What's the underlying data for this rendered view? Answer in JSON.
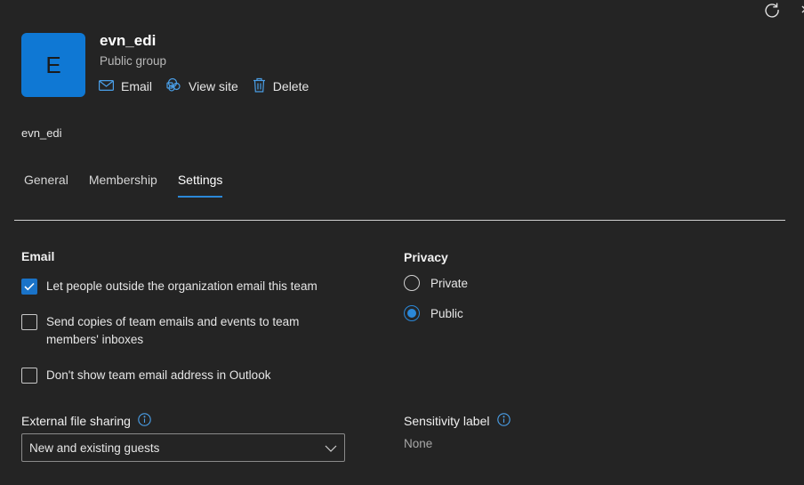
{
  "header": {
    "avatar_letter": "E",
    "group_name": "evn_edi",
    "group_type": "Public group",
    "actions": [
      {
        "label": "Email",
        "icon": "mail-icon"
      },
      {
        "label": "View site",
        "icon": "sharepoint-icon"
      },
      {
        "label": "Delete",
        "icon": "trash-icon"
      }
    ]
  },
  "description": "evn_edi",
  "tabs": [
    {
      "label": "General",
      "active": false
    },
    {
      "label": "Membership",
      "active": false
    },
    {
      "label": "Settings",
      "active": true
    }
  ],
  "email": {
    "title": "Email",
    "options": [
      {
        "label": "Let people outside the organization email this team",
        "checked": true
      },
      {
        "label": "Send copies of team emails and events to team members' inboxes",
        "checked": false
      },
      {
        "label": "Don't show team email address in Outlook",
        "checked": false
      }
    ]
  },
  "privacy": {
    "title": "Privacy",
    "options": [
      {
        "label": "Private",
        "selected": false
      },
      {
        "label": "Public",
        "selected": true
      }
    ]
  },
  "external_sharing": {
    "title": "External file sharing",
    "selected": "New and existing guests"
  },
  "sensitivity": {
    "title": "Sensitivity label",
    "value": "None"
  },
  "colors": {
    "background": "#242424",
    "accent": "#2b88d8",
    "avatar": "#0f78d4"
  }
}
